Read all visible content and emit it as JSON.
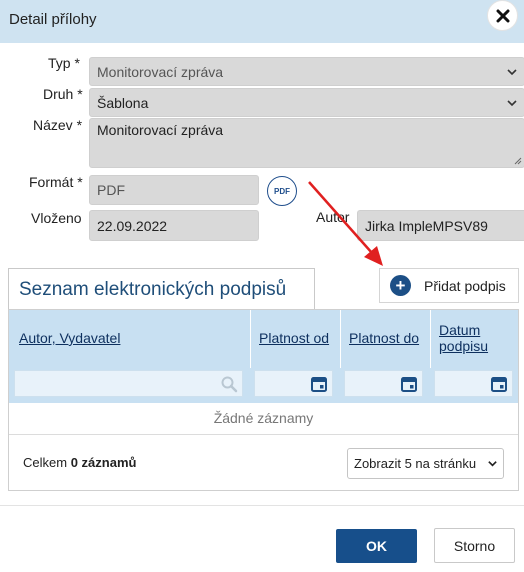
{
  "dialog": {
    "title": "Detail přílohy",
    "close_icon": "close-icon"
  },
  "form": {
    "typ": {
      "label": "Typ *",
      "value": "Monitorovací zpráva"
    },
    "druh": {
      "label": "Druh *",
      "value": "Šablona"
    },
    "nazev": {
      "label": "Název *",
      "value": "Monitorovací zpráva"
    },
    "format": {
      "label": "Formát *",
      "value": "PDF",
      "icon_text": "PDF"
    },
    "vlozeno": {
      "label": "Vloženo",
      "value": "22.09.2022"
    },
    "autor": {
      "label": "Autor",
      "value": "Jirka ImpleMPSV89"
    }
  },
  "signatures": {
    "tab_title": "Seznam elektronických podpisů",
    "add_button": "Přidat podpis",
    "columns": [
      {
        "label": "Autor, Vydavatel"
      },
      {
        "label": "Platnost od"
      },
      {
        "label": "Platnost do"
      },
      {
        "label": "Datum\npodpisu"
      }
    ],
    "empty_text": "Žádné záznamy",
    "total_prefix": "Celkem",
    "total_value": "0 záznamů",
    "page_size_option": "Zobrazit 5 na stránku"
  },
  "actions": {
    "ok": "OK",
    "cancel": "Storno"
  },
  "colors": {
    "header_bg": "#cfe3f1",
    "grid_header_bg": "#c8e0f2",
    "primary": "#174f8b",
    "annotation_arrow": "#e02020"
  }
}
